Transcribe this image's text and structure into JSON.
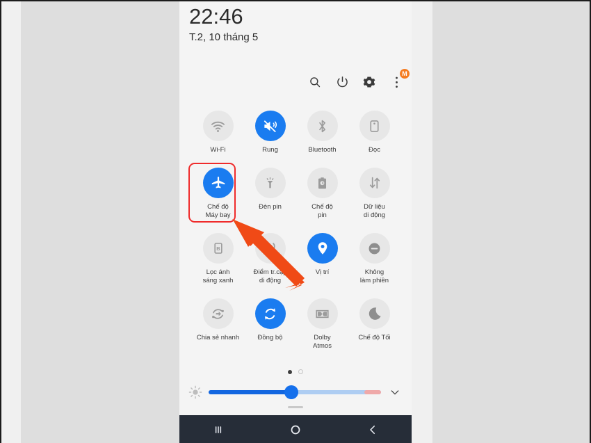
{
  "theme": {
    "accent_on": "#1a7cf0",
    "tile_off_bg": "#e7e7e7",
    "tile_icon_off": "#9b9b9b",
    "highlight_red": "#ef2b2b",
    "arrow_orange": "#f04a16",
    "badge_orange": "#f57c20",
    "navbar_bg": "#262d38",
    "panel_bg": "#f4f4f4",
    "page_bg": "#dedede"
  },
  "status": {
    "time": "22:46",
    "date": "T.2, 10 tháng 5"
  },
  "header_icons": [
    {
      "name": "search-icon",
      "label": "Tìm kiếm"
    },
    {
      "name": "power-icon",
      "label": "Nguồn"
    },
    {
      "name": "gear-icon",
      "label": "Cài đặt"
    },
    {
      "name": "more-options-icon",
      "label": "Thêm",
      "badge": "M"
    }
  ],
  "tiles": [
    {
      "label": "Wi-Fi",
      "icon": "wifi-icon",
      "state": "off",
      "highlighted": false
    },
    {
      "label": "Rung",
      "icon": "vibrate-icon",
      "state": "on",
      "highlighted": false
    },
    {
      "label": "Bluetooth",
      "icon": "bluetooth-icon",
      "state": "off",
      "highlighted": false
    },
    {
      "label": "Đọc",
      "icon": "reading-mode-icon",
      "state": "off",
      "highlighted": false
    },
    {
      "label": "Chế độ\nMáy bay",
      "icon": "airplane-icon",
      "state": "on",
      "highlighted": true
    },
    {
      "label": "Đèn pin",
      "icon": "flashlight-icon",
      "state": "off",
      "highlighted": false
    },
    {
      "label": "Chế độ\npin",
      "icon": "battery-saver-icon",
      "state": "off",
      "highlighted": false
    },
    {
      "label": "Dữ liệu\ndi động",
      "icon": "mobile-data-icon",
      "state": "off",
      "highlighted": false
    },
    {
      "label": "Lọc ánh\nsáng xanh",
      "icon": "blue-light-filter-icon",
      "state": "off",
      "highlighted": false
    },
    {
      "label": "Điểm tr.cập\ndi động",
      "icon": "hotspot-icon",
      "state": "off",
      "highlighted": false
    },
    {
      "label": "Vị trí",
      "icon": "location-pin-icon",
      "state": "on",
      "highlighted": false
    },
    {
      "label": "Không\nlàm phiền",
      "icon": "do-not-disturb-icon",
      "state": "off",
      "highlighted": false
    },
    {
      "label": "Chia sẻ nhanh",
      "icon": "quick-share-icon",
      "state": "off",
      "highlighted": false
    },
    {
      "label": "Đồng bộ",
      "icon": "sync-icon",
      "state": "on",
      "highlighted": false
    },
    {
      "label": "Dolby\nAtmos",
      "icon": "dolby-atmos-icon",
      "state": "off",
      "highlighted": false
    },
    {
      "label": "Chế độ Tối",
      "icon": "dark-mode-moon-icon",
      "state": "off",
      "highlighted": false
    }
  ],
  "pager": {
    "total": 2,
    "active_index": 0
  },
  "brightness": {
    "icon": "brightness-icon",
    "value_percent": 48,
    "expand_icon": "chevron-down-icon"
  },
  "navbar": [
    {
      "name": "recents-button",
      "icon": "recents-icon",
      "label": "Gần đây"
    },
    {
      "name": "home-button",
      "icon": "home-circle-icon",
      "label": "Trang chủ"
    },
    {
      "name": "back-button",
      "icon": "back-chevron-icon",
      "label": "Quay lại"
    }
  ],
  "annotation": {
    "arrow": {
      "name": "pointer-arrow",
      "points_to": "Chế độ Máy bay",
      "color": "#f04a16"
    },
    "highlight_box": {
      "name": "highlight-box",
      "target": "Chế độ Máy bay",
      "color": "#ef2b2b"
    }
  }
}
